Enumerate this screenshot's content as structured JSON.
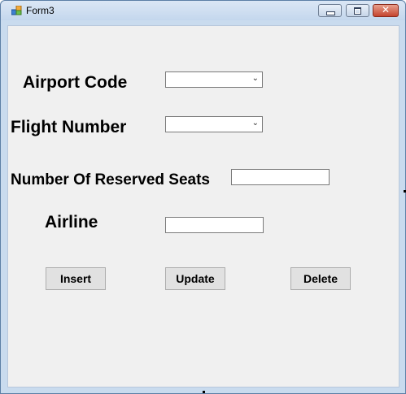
{
  "window": {
    "title": "Form3",
    "close_symbol": "✕",
    "icons": {
      "app": "form-app-icon",
      "minimize": "minimize-icon",
      "maximize": "maximize-icon",
      "close": "close-icon"
    }
  },
  "form": {
    "airport_code_label": "Airport Code",
    "flight_number_label": "Flight Number",
    "reserved_seats_label": "Number Of Reserved Seats",
    "airline_label": "Airline",
    "airport_code_value": "",
    "flight_number_value": "",
    "reserved_seats_value": "",
    "airline_value": "",
    "dropdown_arrow": "⌄"
  },
  "buttons": {
    "insert": "Insert",
    "update": "Update",
    "delete": "Delete"
  }
}
